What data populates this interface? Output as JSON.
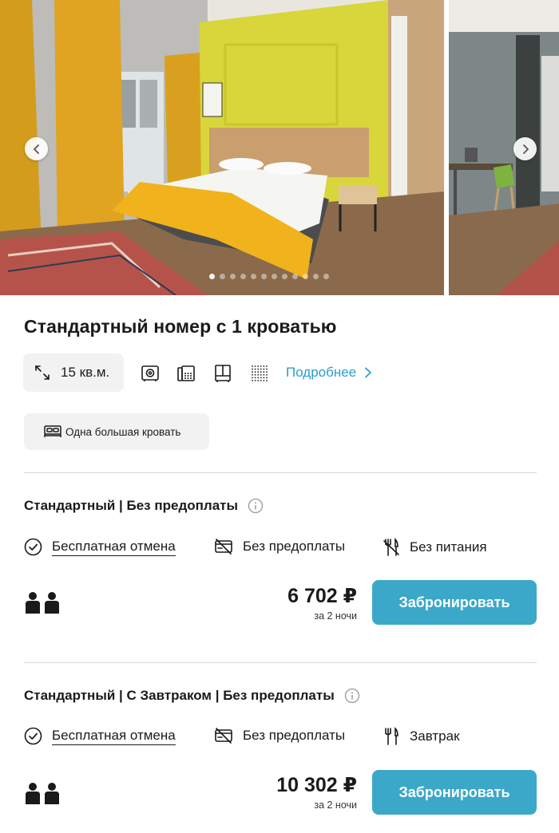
{
  "gallery": {
    "prev_label": "Previous photo",
    "next_label": "Next photo",
    "dots_count": 12,
    "active_dot": 0
  },
  "room": {
    "title": "Стандартный номер с 1 кроватью",
    "area": "15 кв.м.",
    "amenity_icons": [
      "safe-icon",
      "phone-icon",
      "wardrobe-icon",
      "soundproofing-icon"
    ],
    "details_link": "Подробнее",
    "bed": "Одна большая кровать"
  },
  "rates": [
    {
      "title": "Стандартный | Без предоплаты",
      "cancellation": "Бесплатная отмена",
      "payment": "Без предоплаты",
      "meal": "Без питания",
      "meal_icon": "no-meal-icon",
      "guests": 2,
      "price": "6 702 ₽",
      "period": "за 2 ночи",
      "book_label": "Забронировать"
    },
    {
      "title": "Стандартный | С Завтраком | Без предоплаты",
      "cancellation": "Бесплатная отмена",
      "payment": "Без предоплаты",
      "meal": "Завтрак",
      "meal_icon": "breakfast-icon",
      "guests": 2,
      "price": "10 302 ₽",
      "period": "за 2 ночи",
      "book_label": "Забронировать"
    }
  ],
  "colors": {
    "accent": "#3ba8c9",
    "link": "#2c9ec9",
    "chip_bg": "#f2f2f2",
    "divider": "#d6d6d6"
  }
}
